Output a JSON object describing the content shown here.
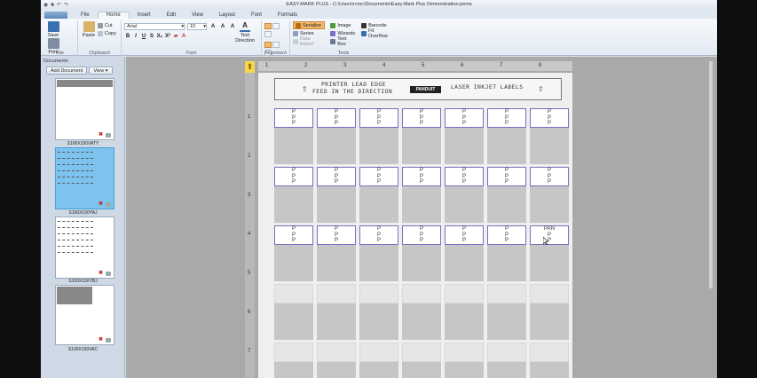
{
  "window": {
    "title": "EASY-MARK PLUS - C:\\Users\\rcmc\\Documents\\Easy-Mark Plus Demonstration.pems"
  },
  "ribbon": {
    "tabs": [
      "File",
      "Home",
      "Insert",
      "Edit",
      "View",
      "Layout",
      "Font",
      "Formats"
    ],
    "active_tab": "Home",
    "file_group": {
      "save": "Save",
      "print": "Print",
      "label": "File"
    },
    "clipboard_group": {
      "paste": "Paste",
      "cut": "Cut",
      "copy": "Copy",
      "label": "Clipboard"
    },
    "font_group": {
      "font_name": "Arial",
      "font_size": "10",
      "text_direction": "Text Direction",
      "label": "Font",
      "bold": "B",
      "italic": "I",
      "underline": "U",
      "strike": "S",
      "sub": "X₂",
      "sup": "X²"
    },
    "alignment_group": {
      "label": "Alignment"
    },
    "tools_group": {
      "serialize": "Serialize",
      "image": "Image",
      "barcode": "Barcode",
      "series": "Series",
      "wizards": "Wizards",
      "fit_overflow": "Fit Overflow",
      "data_import": "Data Import",
      "text_box": "Text Box",
      "label": "Tools"
    }
  },
  "documents_panel": {
    "title": "Documents",
    "add_document": "Add Document",
    "view": "View",
    "items": [
      {
        "name": "S100X150VATY",
        "selected": false
      },
      {
        "name": "S100X150YAJ",
        "selected": true
      },
      {
        "name": "S100X150YBJ",
        "selected": false
      },
      {
        "name": "S100X150VAC",
        "selected": false
      }
    ]
  },
  "canvas": {
    "column_ruler": [
      "1",
      "2",
      "3",
      "4",
      "5",
      "6",
      "7",
      "8"
    ],
    "row_ruler": [
      "1",
      "2",
      "3",
      "4",
      "5",
      "6",
      "7"
    ],
    "header_line1": "PRINTER LEAD EDGE",
    "header_line2": "FEED IN THE DIRECTION",
    "brand_logo": "PANDUIT",
    "header_right": "LASER INKJET LABELS",
    "label_text": [
      "P",
      "P",
      "P"
    ],
    "edited_label_text": [
      "PAN",
      "P",
      "P"
    ]
  }
}
